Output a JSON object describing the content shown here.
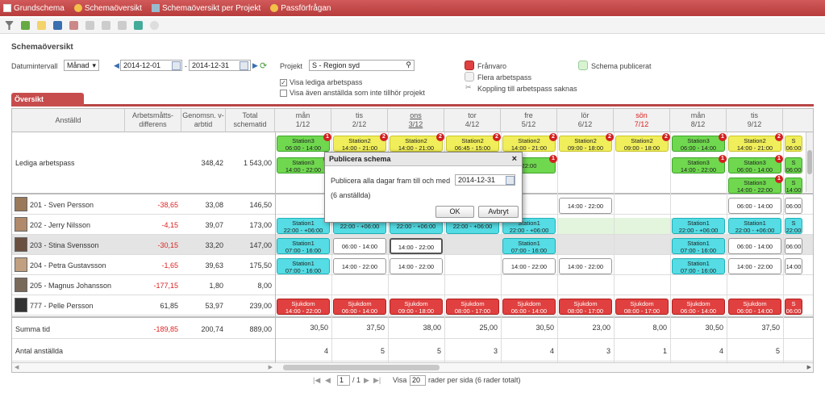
{
  "menu": {
    "items": [
      "Grundschema",
      "Schemaöversikt",
      "Schemaöversikt per Projekt",
      "Passförfrågan"
    ]
  },
  "page": {
    "title": "Schemaöversikt",
    "tab": "Översikt"
  },
  "filters": {
    "datum_label": "Datumintervall",
    "period": "Månad",
    "from": "2014-12-01",
    "sep": "-",
    "to": "2014-12-31",
    "projekt_label": "Projekt",
    "projekt": "S - Region syd",
    "cb1": "Visa lediga arbetspass",
    "cb2": "Visa även anställda som inte tillhör projekt"
  },
  "legend": {
    "franvaro": "Frånvaro",
    "flera": "Flera arbetspass",
    "koppling": "Koppling till arbetspass saknas",
    "publicerat": "Schema publicerat",
    "colors": {
      "franvaro": "#e04040",
      "flera": "#f2f2f2",
      "publicerat": "#d8f3d2"
    }
  },
  "columns": {
    "anstalld": "Anställd",
    "diff": "Arbetsmåtts-differens",
    "snitt": "Genomsn. v-arbtid",
    "total": "Total schematid"
  },
  "days": [
    {
      "d": "mån",
      "n": "1/12"
    },
    {
      "d": "tis",
      "n": "2/12"
    },
    {
      "d": "ons",
      "n": "3/12"
    },
    {
      "d": "tor",
      "n": "4/12"
    },
    {
      "d": "fre",
      "n": "5/12"
    },
    {
      "d": "lör",
      "n": "6/12"
    },
    {
      "d": "sön",
      "n": "7/12"
    },
    {
      "d": "mån",
      "n": "8/12"
    },
    {
      "d": "tis",
      "n": "9/12"
    },
    {
      "d": "",
      "n": ""
    }
  ],
  "lediga": {
    "label": "Lediga arbetspass",
    "snitt": "348,42",
    "total": "1 543,00"
  },
  "employees": [
    {
      "name": "201 - Sven Persson",
      "diff": "-38,65",
      "snitt": "33,08",
      "total": "146,50"
    },
    {
      "name": "202 - Jerry Nilsson",
      "diff": "-4,15",
      "snitt": "39,07",
      "total": "173,00"
    },
    {
      "name": "203 - Stina Svensson",
      "diff": "-30,15",
      "snitt": "33,20",
      "total": "147,00"
    },
    {
      "name": "204 - Petra Gustavsson",
      "diff": "-1,65",
      "snitt": "39,63",
      "total": "175,50"
    },
    {
      "name": "205 - Magnus Johansson",
      "diff": "-177,15",
      "snitt": "1,80",
      "total": "8,00"
    },
    {
      "name": "777 - Pelle Persson",
      "diff": "61,85",
      "snitt": "53,97",
      "total": "239,00"
    }
  ],
  "summa": {
    "label": "Summa tid",
    "diff": "-189,85",
    "snitt": "200,74",
    "total": "889,00",
    "days": [
      "30,50",
      "37,50",
      "38,00",
      "25,00",
      "30,50",
      "23,00",
      "8,00",
      "30,50",
      "37,50"
    ]
  },
  "antal": {
    "label": "Antal anställda",
    "days": [
      "4",
      "5",
      "5",
      "3",
      "4",
      "3",
      "1",
      "4",
      "5"
    ]
  },
  "shifts": {
    "lediga1": [
      [
        "Station3",
        "06:00 - 14:00",
        "g",
        "1"
      ],
      [
        "Station2",
        "14:00 - 21:00",
        "y",
        "2"
      ],
      [
        "Station2",
        "14:00 - 21:00",
        "y",
        "2"
      ],
      [
        "Station2",
        "06:45 - 15:00",
        "y",
        "2"
      ],
      [
        "Station2",
        "14:00 - 21:00",
        "y",
        "2"
      ],
      [
        "Station2",
        "09:00 - 18:00",
        "y",
        "2"
      ],
      [
        "Station2",
        "09:00 - 18:00",
        "y",
        "2"
      ],
      [
        "Station3",
        "06:00 - 14:00",
        "g",
        "1"
      ],
      [
        "Station2",
        "14:00 - 21:00",
        "y",
        "2"
      ],
      [
        "S",
        "06:00",
        "y",
        ""
      ]
    ],
    "lediga2": [
      [
        "Station3",
        "14:00 - 22:00",
        "g",
        "1"
      ],
      null,
      null,
      null,
      [
        "",
        "22:00",
        "g",
        "1"
      ],
      null,
      null,
      [
        "Station3",
        "14:00 - 22:00",
        "g",
        "1"
      ],
      [
        "Station3",
        "06:00 - 14:00",
        "g",
        "1"
      ],
      [
        "S",
        "06:00",
        "g",
        ""
      ]
    ],
    "lediga3": [
      null,
      null,
      null,
      null,
      null,
      null,
      null,
      null,
      [
        "Station3",
        "14:00 - 22:00",
        "g",
        "1"
      ],
      [
        "S",
        "14:00",
        "g",
        ""
      ]
    ],
    "sven": [
      null,
      null,
      null,
      null,
      null,
      [
        "",
        "14:00 - 22:00",
        "w",
        ""
      ],
      null,
      null,
      [
        "",
        "06:00 - 14:00",
        "w",
        ""
      ],
      [
        "",
        "06:00",
        "w",
        ""
      ]
    ],
    "jerry": [
      [
        "Station1",
        "22:00 - +06:00",
        "c",
        ""
      ],
      [
        "",
        "22:00 - +06:00",
        "c",
        ""
      ],
      [
        "",
        "22:00 - +06:00",
        "c",
        ""
      ],
      [
        "",
        "22:00 - +06:00",
        "c",
        ""
      ],
      [
        "Station1",
        "22:00 - +06:00",
        "c",
        ""
      ],
      null,
      null,
      [
        "Station1",
        "22:00 - +06:00",
        "c",
        ""
      ],
      [
        "Station1",
        "22:00 - +06:00",
        "c",
        ""
      ],
      [
        "S",
        "22:00",
        "c",
        ""
      ]
    ],
    "stina": [
      [
        "Station1",
        "07:00 - 16:00",
        "c",
        ""
      ],
      [
        "",
        "06:00 - 14:00",
        "w",
        ""
      ],
      [
        "",
        "14:00 - 22:00",
        "ws",
        ""
      ],
      null,
      [
        "Station1",
        "07:00 - 16:00",
        "c",
        ""
      ],
      null,
      null,
      [
        "Station1",
        "07:00 - 16:00",
        "c",
        ""
      ],
      [
        "",
        "06:00 - 14:00",
        "w",
        ""
      ],
      [
        "",
        "06:00",
        "w",
        ""
      ]
    ],
    "petra": [
      [
        "Station1",
        "07:00 - 16:00",
        "c",
        ""
      ],
      [
        "",
        "14:00 - 22:00",
        "w",
        ""
      ],
      [
        "",
        "14:00 - 22:00",
        "w",
        ""
      ],
      null,
      [
        "",
        "14:00 - 22:00",
        "w",
        ""
      ],
      [
        "",
        "14:00 - 22:00",
        "w",
        ""
      ],
      null,
      [
        "Station1",
        "07:00 - 16:00",
        "c",
        ""
      ],
      [
        "",
        "14:00 - 22:00",
        "w",
        ""
      ],
      [
        "",
        "14:00",
        "w",
        ""
      ]
    ],
    "pelle": [
      [
        "Sjukdom",
        "14:00 - 22:00",
        "r",
        ""
      ],
      [
        "Sjukdom",
        "06:00 - 14:00",
        "r",
        ""
      ],
      [
        "Sjukdom",
        "09:00 - 18:00",
        "r",
        ""
      ],
      [
        "Sjukdom",
        "08:00 - 17:00",
        "r",
        ""
      ],
      [
        "Sjukdom",
        "06:00 - 14:00",
        "r",
        ""
      ],
      [
        "Sjukdom",
        "08:00 - 17:00",
        "r",
        ""
      ],
      [
        "Sjukdom",
        "08:00 - 17:00",
        "r",
        ""
      ],
      [
        "Sjukdom",
        "06:00 - 14:00",
        "r",
        ""
      ],
      [
        "Sjukdom",
        "06:00 - 14:00",
        "r",
        ""
      ],
      [
        "S",
        "06:00",
        "r",
        ""
      ]
    ]
  },
  "dialog": {
    "title": "Publicera schema",
    "close": "×",
    "label": "Publicera alla dagar fram till och med",
    "date": "2014-12-31",
    "note": "(6 anställda)",
    "ok": "OK",
    "cancel": "Avbryt"
  },
  "pager": {
    "page": "1",
    "of": "/ 1",
    "visa": "Visa",
    "rows": "20",
    "suffix": "rader per sida (6 rader totalt)"
  }
}
